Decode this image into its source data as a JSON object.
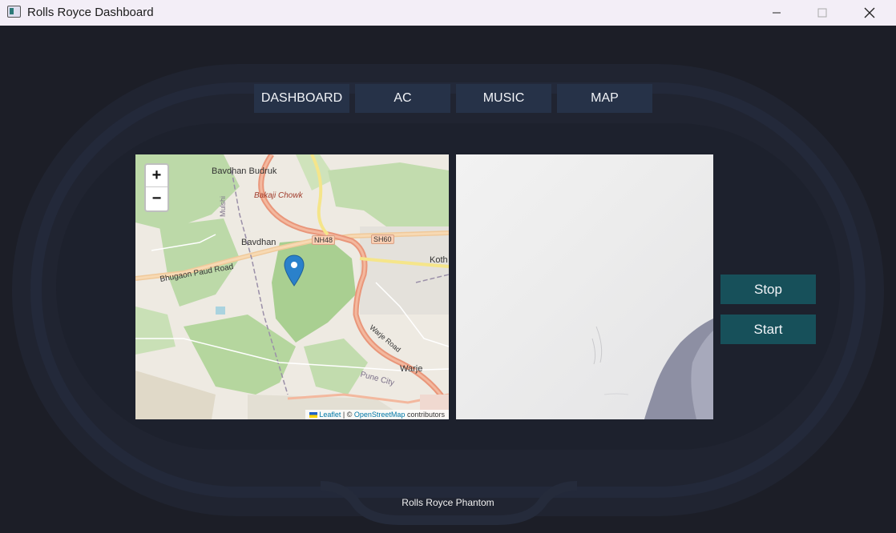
{
  "window": {
    "title": "Rolls Royce Dashboard"
  },
  "nav": [
    {
      "label": "DASHBOARD"
    },
    {
      "label": "AC"
    },
    {
      "label": "MUSIC"
    },
    {
      "label": "MAP"
    }
  ],
  "map": {
    "zoom_in": "+",
    "zoom_out": "−",
    "labels": {
      "bavdhan_budruk": "Bavdhan Budruk",
      "bakaji_chowk": "Bakaji Chowk",
      "bavdhan": "Bavdhan",
      "nh48": "NH48",
      "sh60": "SH60",
      "koth": "Koth",
      "bhugaon_road": "Bhugaon Paud Road",
      "mulshi": "Mulshi",
      "warje_road": "Warje Road",
      "pune_city": "Pune City",
      "warje": "Warje"
    },
    "attribution": {
      "leaflet": "Leaflet",
      "sep": "| ©",
      "osm": "OpenStreetMap",
      "contributors": "contributors"
    }
  },
  "controls": {
    "stop_label": "Stop",
    "start_label": "Start"
  },
  "footer": {
    "text": "Rolls Royce Phantom"
  },
  "colors": {
    "background": "#1c1e27",
    "nav_button": "#263248",
    "action_button": "#17505a",
    "marker": "#2a81cb"
  }
}
